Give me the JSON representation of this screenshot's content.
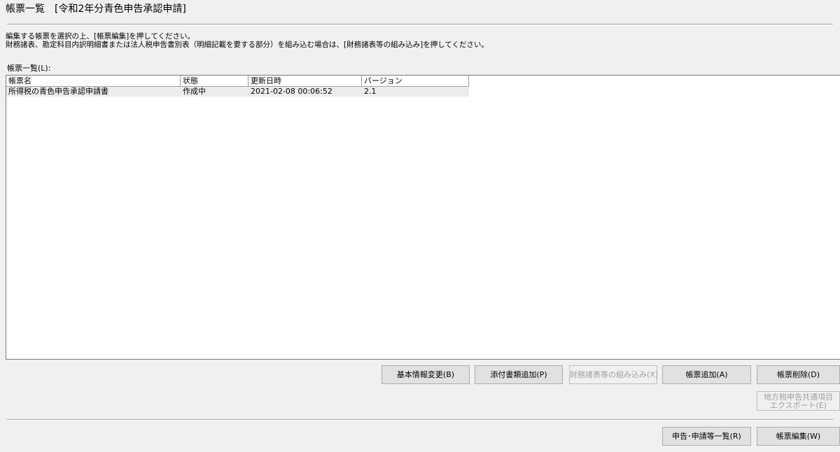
{
  "window": {
    "title": "帳票一覧　[令和2年分青色申告承認申請]"
  },
  "instructions": [
    "編集する帳票を選択の上、[帳票編集]を押してください。",
    "財務諸表、勘定科目内訳明細書または法人税申告書別表（明細記載を要する部分）を組み込む場合は、[財務諸表等の組み込み]を押してください。"
  ],
  "list": {
    "label": "帳票一覧(L):",
    "columns": [
      "帳票名",
      "状態",
      "更新日時",
      "バージョン"
    ],
    "rows": [
      {
        "name": "所得税の青色申告承認申請書",
        "status": "作成中",
        "updated": "2021-02-08 00:06:52",
        "version": "2.1"
      }
    ]
  },
  "buttons": {
    "basic_info": "基本情報変更(B)",
    "add_attachment": "添付書類追加(P)",
    "embed_financial": "財務諸表等の組み込み(X)",
    "add_form": "帳票追加(A)",
    "delete_form": "帳票削除(D)",
    "local_tax_export_line1": "地方税申告共通項目",
    "local_tax_export_line2": "エクスポート(E)",
    "filing_list": "申告･申請等一覧(R)",
    "edit_form": "帳票編集(W)"
  }
}
